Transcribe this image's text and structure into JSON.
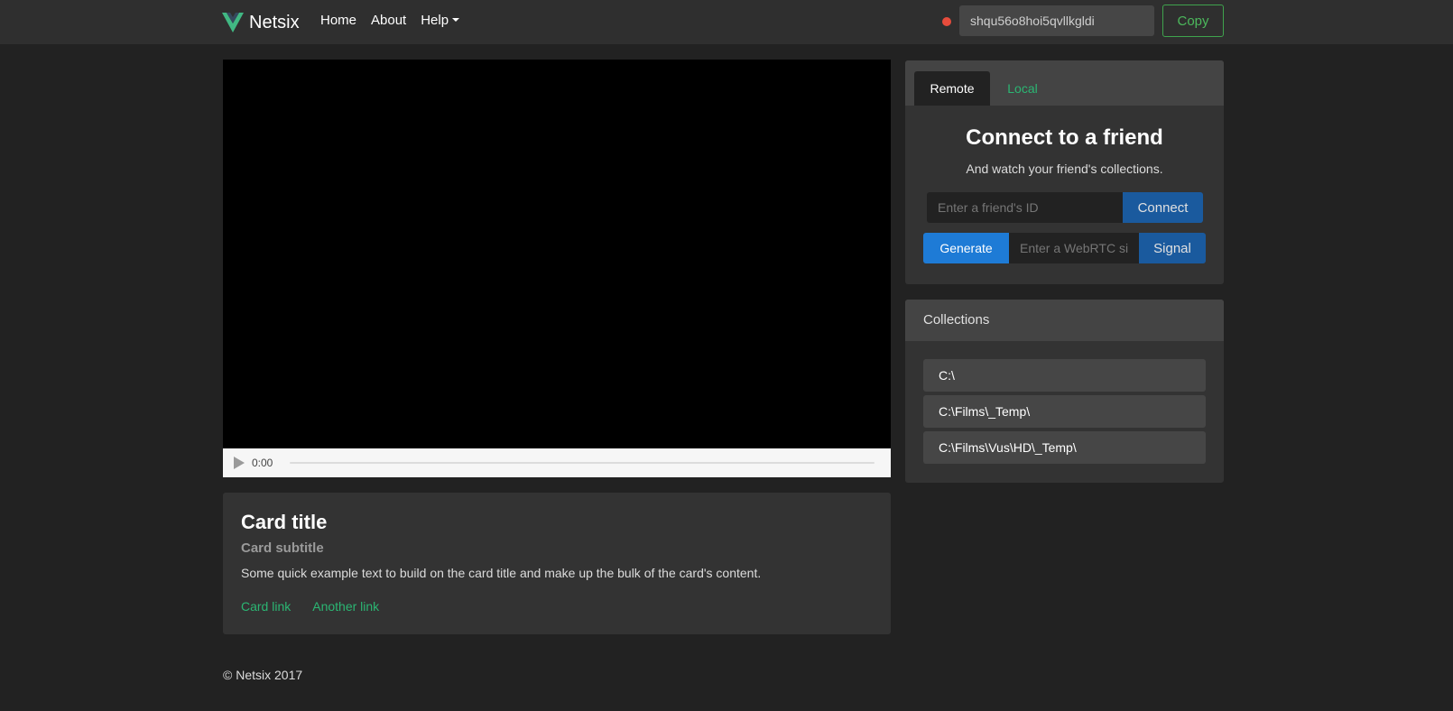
{
  "navbar": {
    "brand": "Netsix",
    "links": [
      "Home",
      "About",
      "Help"
    ],
    "peer_id": "shqu56o8hoi5qvllkgldi",
    "copy_label": "Copy",
    "status_color": "#e74c3c"
  },
  "video": {
    "time": "0:00",
    "progress": 0
  },
  "card": {
    "title": "Card title",
    "subtitle": "Card subtitle",
    "text": "Some quick example text to build on the card title and make up the bulk of the card's content.",
    "links": [
      "Card link",
      "Another link"
    ]
  },
  "connect": {
    "tabs": [
      "Remote",
      "Local"
    ],
    "active_tab": "Remote",
    "title": "Connect to a friend",
    "subtitle": "And watch your friend's collections.",
    "friend_placeholder": "Enter a friend's ID",
    "connect_label": "Connect",
    "generate_label": "Generate",
    "webrtc_placeholder": "Enter a WebRTC signal",
    "signal_label": "Signal"
  },
  "collections": {
    "header": "Collections",
    "items": [
      "C:\\",
      "C:\\Films\\_Temp\\",
      "C:\\Films\\Vus\\HD\\_Temp\\"
    ]
  },
  "footer": {
    "text": "© Netsix 2017"
  },
  "colors": {
    "accent_green": "#2bb673",
    "primary_blue": "#1e7bd6",
    "dark_blue": "#1a5a9e"
  }
}
